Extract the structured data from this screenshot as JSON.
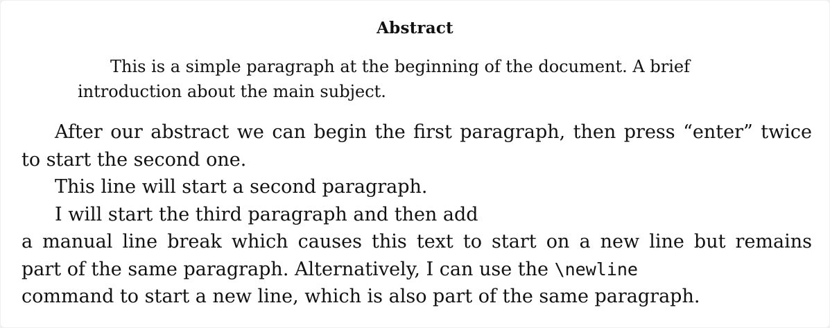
{
  "abstract": {
    "title": "Abstract",
    "line1": "This is a simple paragraph at the beginning of the document. A brief",
    "line2": "introduction about the main subject."
  },
  "body": {
    "p1_line1": "After our abstract we can begin the first paragraph, then press “enter” twice",
    "p1_line2": "to start the second one.",
    "p2_line1": "This line will start a second paragraph.",
    "p3_line1": "I will start the third paragraph and then add",
    "p3_line2": "a manual line break which causes this text to start on a new line but remains",
    "p3_line3_prefix": "part of the same paragraph. Alternatively, I can use the ",
    "p3_line3_code": "\\newline",
    "p3_line4": "command to start a new line, which is also part of the same paragraph."
  }
}
